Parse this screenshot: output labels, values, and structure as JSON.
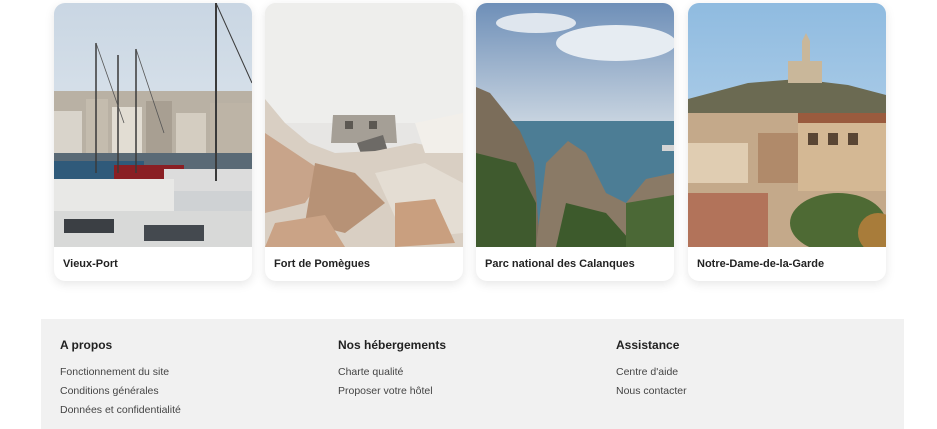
{
  "cards": [
    {
      "title": "Vieux-Port",
      "image_icon": "harbor-photo"
    },
    {
      "title": "Fort de Pomègues",
      "image_icon": "fort-photo"
    },
    {
      "title": "Parc national des Calanques",
      "image_icon": "calanques-photo"
    },
    {
      "title": "Notre-Dame-de-la-Garde",
      "image_icon": "basilica-photo"
    }
  ],
  "footer": {
    "columns": [
      {
        "heading": "A propos",
        "links": [
          "Fonctionnement du site",
          "Conditions générales",
          "Données et confidentialité"
        ]
      },
      {
        "heading": "Nos hébergements",
        "links": [
          "Charte qualité",
          "Proposer votre hôtel"
        ]
      },
      {
        "heading": "Assistance",
        "links": [
          "Centre d'aide",
          "Nous contacter"
        ]
      }
    ]
  },
  "colors": {
    "footer_background": "#f1f1f1",
    "card_background": "#ffffff",
    "text_primary": "#222222",
    "text_secondary": "#444444"
  }
}
